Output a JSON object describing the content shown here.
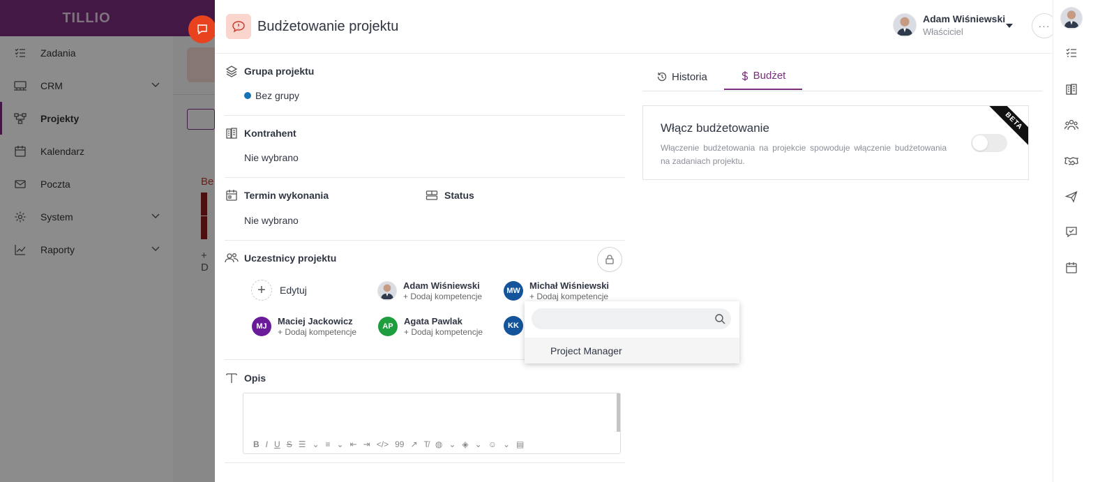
{
  "app": {
    "brand": "TILLIO",
    "nav": [
      {
        "label": "Zadania",
        "icon": "tasks-icon",
        "active": false,
        "expandable": false
      },
      {
        "label": "CRM",
        "icon": "crm-icon",
        "active": false,
        "expandable": true
      },
      {
        "label": "Projekty",
        "icon": "projects-icon",
        "active": true,
        "expandable": false
      },
      {
        "label": "Kalendarz",
        "icon": "calendar-icon",
        "active": false,
        "expandable": false
      },
      {
        "label": "Poczta",
        "icon": "mail-icon",
        "active": false,
        "expandable": false
      },
      {
        "label": "System",
        "icon": "gear-icon",
        "active": false,
        "expandable": true
      },
      {
        "label": "Raporty",
        "icon": "chart-icon",
        "active": false,
        "expandable": true
      }
    ],
    "background": {
      "text": "Be",
      "plus": "+ D"
    }
  },
  "modal": {
    "title": "Budżetowanie projektu",
    "user": {
      "name": "Adam Wiśniewski",
      "role": "Właściciel"
    },
    "more_label": "···",
    "group": {
      "label": "Grupa projektu",
      "value": "Bez grupy",
      "dot_color": "#1673b4"
    },
    "contractor": {
      "label": "Kontrahent",
      "value": "Nie wybrano"
    },
    "deadline": {
      "label": "Termin wykonania",
      "value": "Nie wybrano"
    },
    "status": {
      "label": "Status"
    },
    "participants": {
      "label": "Uczestnicy projektu",
      "edit_label": "Edytuj",
      "items": [
        {
          "name": "Adam Wiśniewski",
          "comp": "+ Dodaj kompetencje",
          "initials": "",
          "color": "photo"
        },
        {
          "name": "Michał Wiśniewski",
          "comp": "+ Dodaj kompetencje",
          "initials": "MW",
          "color": "#14549a"
        },
        {
          "name": "Maciej Jackowicz",
          "comp": "+ Dodaj kompetencje",
          "initials": "MJ",
          "color": "#6a1b9a"
        },
        {
          "name": "Agata Pawlak",
          "comp": "+ Dodaj kompetencje",
          "initials": "AP",
          "color": "#1e9e3e"
        },
        {
          "name": "",
          "comp": "",
          "initials": "KK",
          "color": "#14549a"
        }
      ]
    },
    "description": {
      "label": "Opis",
      "toolbar": [
        "B",
        "I",
        "U",
        "S",
        "☰",
        "⌄",
        "≡",
        "⌄",
        "⇤",
        "⇥",
        "</>",
        "99",
        "↗",
        "T̸",
        "◍",
        "⌄",
        "◈",
        "⌄",
        "☺",
        "⌄",
        "▤"
      ]
    },
    "dropdown": {
      "search_placeholder": "",
      "search_value": "",
      "options": [
        "Project Manager"
      ]
    },
    "tabs": [
      {
        "label": "Historia",
        "icon": "history-icon",
        "active": false
      },
      {
        "label": "Budżet",
        "icon": "dollar-icon",
        "active": true
      }
    ],
    "budget": {
      "title": "Włącz budżetowanie",
      "description": "Włączenie budżetowania na projekcie spowoduje włączenie budżetowania na zadaniach projektu.",
      "enabled": false,
      "badge": "BETA"
    }
  },
  "colors": {
    "brand": "#7b2d7f",
    "accent": "#7b2d7f",
    "fab": "#e8431e"
  }
}
